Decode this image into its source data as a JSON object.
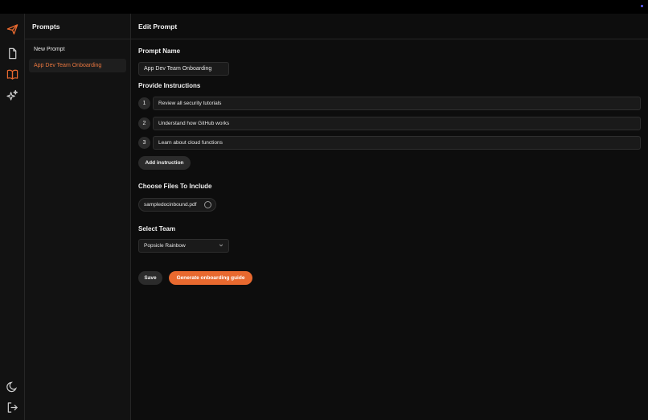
{
  "sidebar": {
    "title": "Prompts",
    "new_prompt": "New Prompt",
    "items": [
      {
        "label": "App Dev Team Onboarding"
      }
    ]
  },
  "main": {
    "header": "Edit Prompt",
    "prompt_name_label": "Prompt Name",
    "prompt_name_value": "App Dev Team Onboarding",
    "instructions_label": "Provide Instructions",
    "instructions": [
      {
        "num": "1",
        "text": "Review all security tutorials"
      },
      {
        "num": "2",
        "text": "Understand how GitHub works"
      },
      {
        "num": "3",
        "text": "Learn about cloud functions"
      }
    ],
    "add_instruction": "Add instruction",
    "files_label": "Choose Files To Include",
    "file_name": "sampledocinbound.pdf",
    "team_label": "Select Team",
    "team_value": "Popsicle Rainbow",
    "save": "Save",
    "generate": "Generate onboarding guide"
  },
  "colors": {
    "accent": "#e8692f",
    "accent_text": "#e8763f",
    "background": "#0d0d0d",
    "panel": "#121212"
  },
  "icons": {
    "logo": "paper-plane-icon",
    "rail": [
      "document-icon",
      "book-icon",
      "sparkles-icon",
      "moon-icon",
      "logout-icon"
    ]
  }
}
